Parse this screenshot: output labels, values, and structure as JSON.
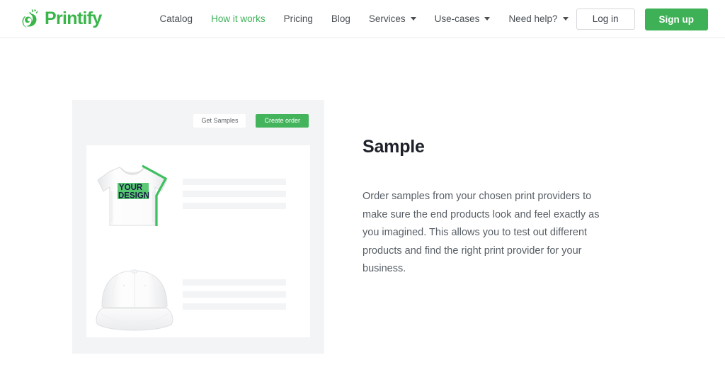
{
  "header": {
    "logo": {
      "text": "Printify",
      "icon": "printify-leaf-icon",
      "color": "#39b54a"
    },
    "nav": [
      {
        "label": "Catalog",
        "active": false,
        "dropdown": false
      },
      {
        "label": "How it works",
        "active": true,
        "dropdown": false
      },
      {
        "label": "Pricing",
        "active": false,
        "dropdown": false
      },
      {
        "label": "Blog",
        "active": false,
        "dropdown": false
      },
      {
        "label": "Services",
        "active": false,
        "dropdown": true
      },
      {
        "label": "Use-cases",
        "active": false,
        "dropdown": true
      },
      {
        "label": "Need help?",
        "active": false,
        "dropdown": true
      }
    ],
    "login_label": "Log in",
    "signup_label": "Sign up"
  },
  "mock": {
    "get_samples_label": "Get Samples",
    "create_order_label": "Create order",
    "products": [
      {
        "name": "t-shirt",
        "design_text_line1": "YOUR",
        "design_text_line2": "DESIGN",
        "selected": true
      },
      {
        "name": "cap",
        "selected": false
      }
    ],
    "panel_bg": "#f3f4f6",
    "card_bg": "#ffffff",
    "placeholder_bar_color": "#f3f4f6",
    "selection_outline_color": "#3fbf5f"
  },
  "copy": {
    "title": "Sample",
    "body": "Order samples from your chosen print providers to make sure the end products look and feel exactly as you imagined. This allows you to test out different products and find the right print provider for your business."
  },
  "theme": {
    "brand_green": "#3eb157",
    "text_dark": "#1d2129",
    "text_body": "#585f66",
    "border": "#ebecee"
  }
}
